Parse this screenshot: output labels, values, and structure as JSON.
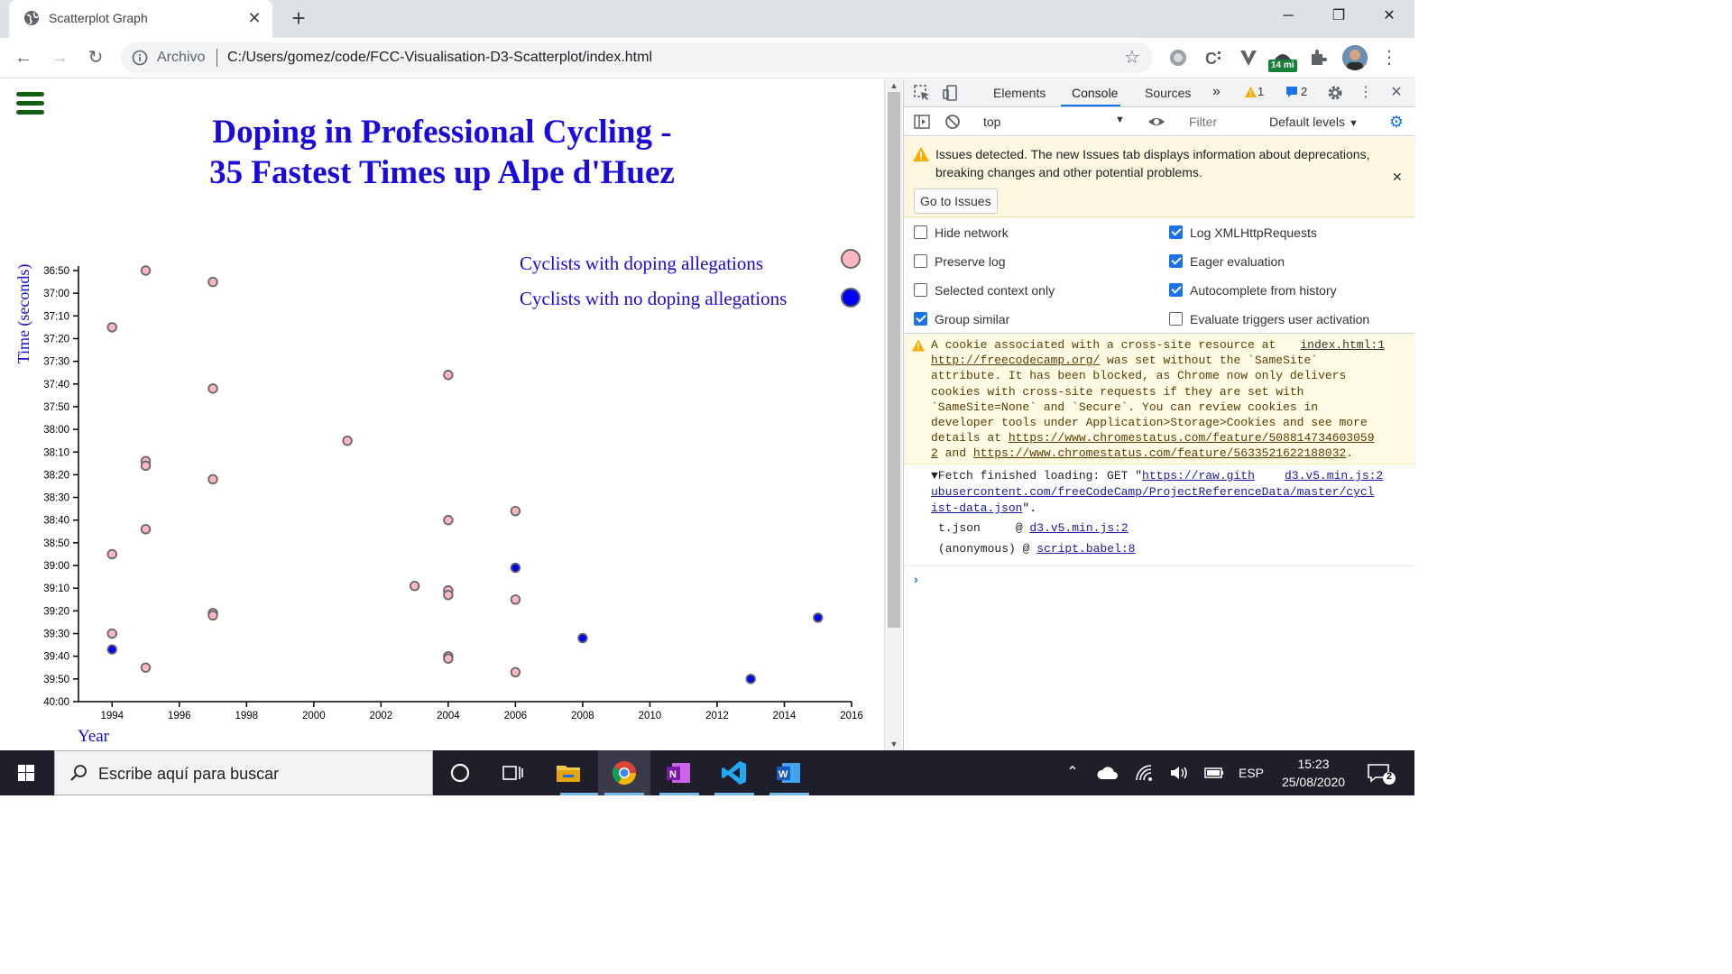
{
  "browser": {
    "tab_title": "Scatterplot Graph",
    "new_tab_symbol": "+",
    "address_prefix": "Archivo",
    "url": "C:/Users/gomez/code/FCC-Visualisation-D3-Scatterplot/index.html",
    "extension_badge": "14 mi"
  },
  "page": {
    "title_line1": "Doping in Professional Cycling -",
    "title_line2": "35 Fastest Times up Alpe d'Huez",
    "legend": {
      "doping": "Cyclists with doping allegations",
      "clean": "Cyclists with no doping allegations"
    },
    "colors": {
      "doping": "#ffb6c1",
      "clean": "#0000ff",
      "title": "#1a0adb",
      "hamburger": "#136013"
    }
  },
  "chart_data": {
    "type": "scatter",
    "xlabel": "Year",
    "ylabel": "Time (seconds)",
    "xlim": [
      1993,
      2016
    ],
    "ylim": [
      "36:50",
      "40:00"
    ],
    "x_ticks": [
      "1994",
      "1996",
      "1998",
      "2000",
      "2002",
      "2004",
      "2006",
      "2008",
      "2010",
      "2012",
      "2014",
      "2016"
    ],
    "y_ticks": [
      "36:50",
      "37:00",
      "37:10",
      "37:20",
      "37:30",
      "37:40",
      "37:50",
      "38:00",
      "38:10",
      "38:20",
      "38:30",
      "38:40",
      "38:50",
      "39:00",
      "39:10",
      "39:20",
      "39:30",
      "39:40",
      "39:50",
      "40:00"
    ],
    "series": [
      {
        "name": "Cyclists with doping allegations",
        "points": [
          {
            "x": 1995,
            "y": "36:50"
          },
          {
            "x": 1997,
            "y": "36:55"
          },
          {
            "x": 1994,
            "y": "37:15"
          },
          {
            "x": 2004,
            "y": "37:36"
          },
          {
            "x": 1997,
            "y": "37:42"
          },
          {
            "x": 2001,
            "y": "38:05"
          },
          {
            "x": 1995,
            "y": "38:14"
          },
          {
            "x": 1995,
            "y": "38:16"
          },
          {
            "x": 1997,
            "y": "38:22"
          },
          {
            "x": 2006,
            "y": "38:36"
          },
          {
            "x": 2004,
            "y": "38:40"
          },
          {
            "x": 1995,
            "y": "38:44"
          },
          {
            "x": 1994,
            "y": "38:55"
          },
          {
            "x": 2003,
            "y": "39:09"
          },
          {
            "x": 2004,
            "y": "39:11"
          },
          {
            "x": 2004,
            "y": "39:13"
          },
          {
            "x": 2006,
            "y": "39:15"
          },
          {
            "x": 1997,
            "y": "39:21"
          },
          {
            "x": 1997,
            "y": "39:22"
          },
          {
            "x": 1994,
            "y": "39:30"
          },
          {
            "x": 2004,
            "y": "39:40"
          },
          {
            "x": 2004,
            "y": "39:41"
          },
          {
            "x": 1995,
            "y": "39:45"
          },
          {
            "x": 2006,
            "y": "39:47"
          }
        ]
      },
      {
        "name": "Cyclists with no doping allegations",
        "points": [
          {
            "x": 2006,
            "y": "39:01"
          },
          {
            "x": 2015,
            "y": "39:23"
          },
          {
            "x": 2008,
            "y": "39:32"
          },
          {
            "x": 1994,
            "y": "39:37"
          },
          {
            "x": 2013,
            "y": "39:50"
          }
        ]
      }
    ]
  },
  "devtools": {
    "tabs": [
      "Elements",
      "Console",
      "Sources"
    ],
    "more_tabs": "»",
    "warn_count": "1",
    "info_count": "2",
    "context": "top",
    "filter_placeholder": "Filter",
    "levels": "Default levels",
    "issues_text": "Issues detected. The new Issues tab displays information about deprecations, breaking changes and other potential problems.",
    "issues_button": "Go to Issues",
    "options": [
      {
        "label": "Hide network",
        "checked": false
      },
      {
        "label": "Log XMLHttpRequests",
        "checked": true
      },
      {
        "label": "Preserve log",
        "checked": false
      },
      {
        "label": "Eager evaluation",
        "checked": true
      },
      {
        "label": "Selected context only",
        "checked": false
      },
      {
        "label": "Autocomplete from history",
        "checked": true
      },
      {
        "label": "Group similar",
        "checked": true
      },
      {
        "label": "Evaluate triggers user activation",
        "checked": false
      }
    ],
    "warning": {
      "source": "index.html:1",
      "text_a": "A cookie associated with a cross-site resource at",
      "link1": "http://freecodecamp.org/",
      "text_b": " was set without the `SameSite`\nattribute. It has been blocked, as Chrome now only delivers\ncookies with cross-site requests if they are set with\n`SameSite=None` and `Secure`. You can review cookies in\ndeveloper tools under Application>Storage>Cookies and see more\ndetails at ",
      "link2": "https://www.chromestatus.com/feature/508814734603059\n2",
      "text_c": " and ",
      "link3": "https://www.chromestatus.com/feature/5633521622188032",
      "text_d": "."
    },
    "fetch": {
      "source": "d3.v5.min.js:2",
      "prefix": "▼Fetch finished loading: GET \"",
      "link": "https://raw.gith\nubusercontent.com/freeCodeCamp/ProjectReferenceData/master/cycl\nist-data.json",
      "suffix": "\"."
    },
    "trace": [
      {
        "fn": "t.json     @ ",
        "src": "d3.v5.min.js:2"
      },
      {
        "fn": "(anonymous) @ ",
        "src": "script.babel:8"
      }
    ],
    "prompt": "›"
  },
  "taskbar": {
    "search_placeholder": "Escribe aquí para buscar",
    "lang": "ESP",
    "time": "15:23",
    "date": "25/08/2020",
    "notifications": "2"
  }
}
